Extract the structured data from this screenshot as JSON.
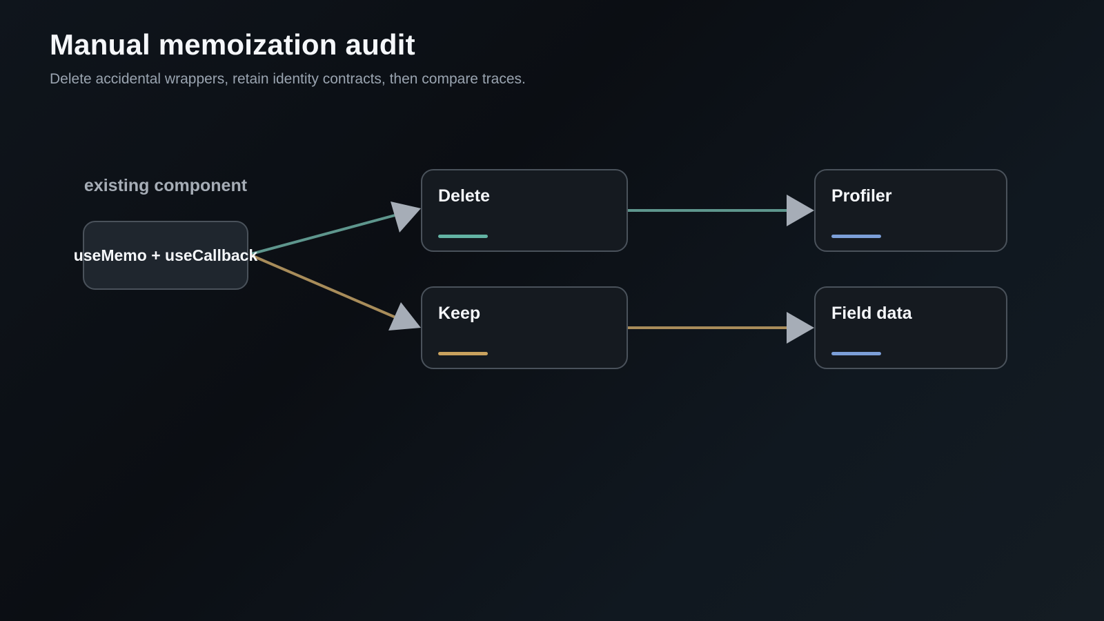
{
  "header": {
    "title": "Manual memoization audit",
    "subtitle": "Delete accidental wrappers, retain identity contracts, then compare traces."
  },
  "source": {
    "caption": "existing component",
    "label": "useMemo + useCallback"
  },
  "nodes": {
    "delete": {
      "label": "Delete",
      "accent": "#63b3a4"
    },
    "keep": {
      "label": "Keep",
      "accent": "#c9a25e"
    },
    "profiler": {
      "label": "Profiler",
      "accent": "#7c9fd8"
    },
    "field_data": {
      "label": "Field data",
      "accent": "#7c9fd8"
    }
  },
  "colors": {
    "edge_delete": "#5e968d",
    "edge_keep": "#a88c5a",
    "arrowhead": "#a6adb7",
    "node_border": "#4a525b"
  }
}
